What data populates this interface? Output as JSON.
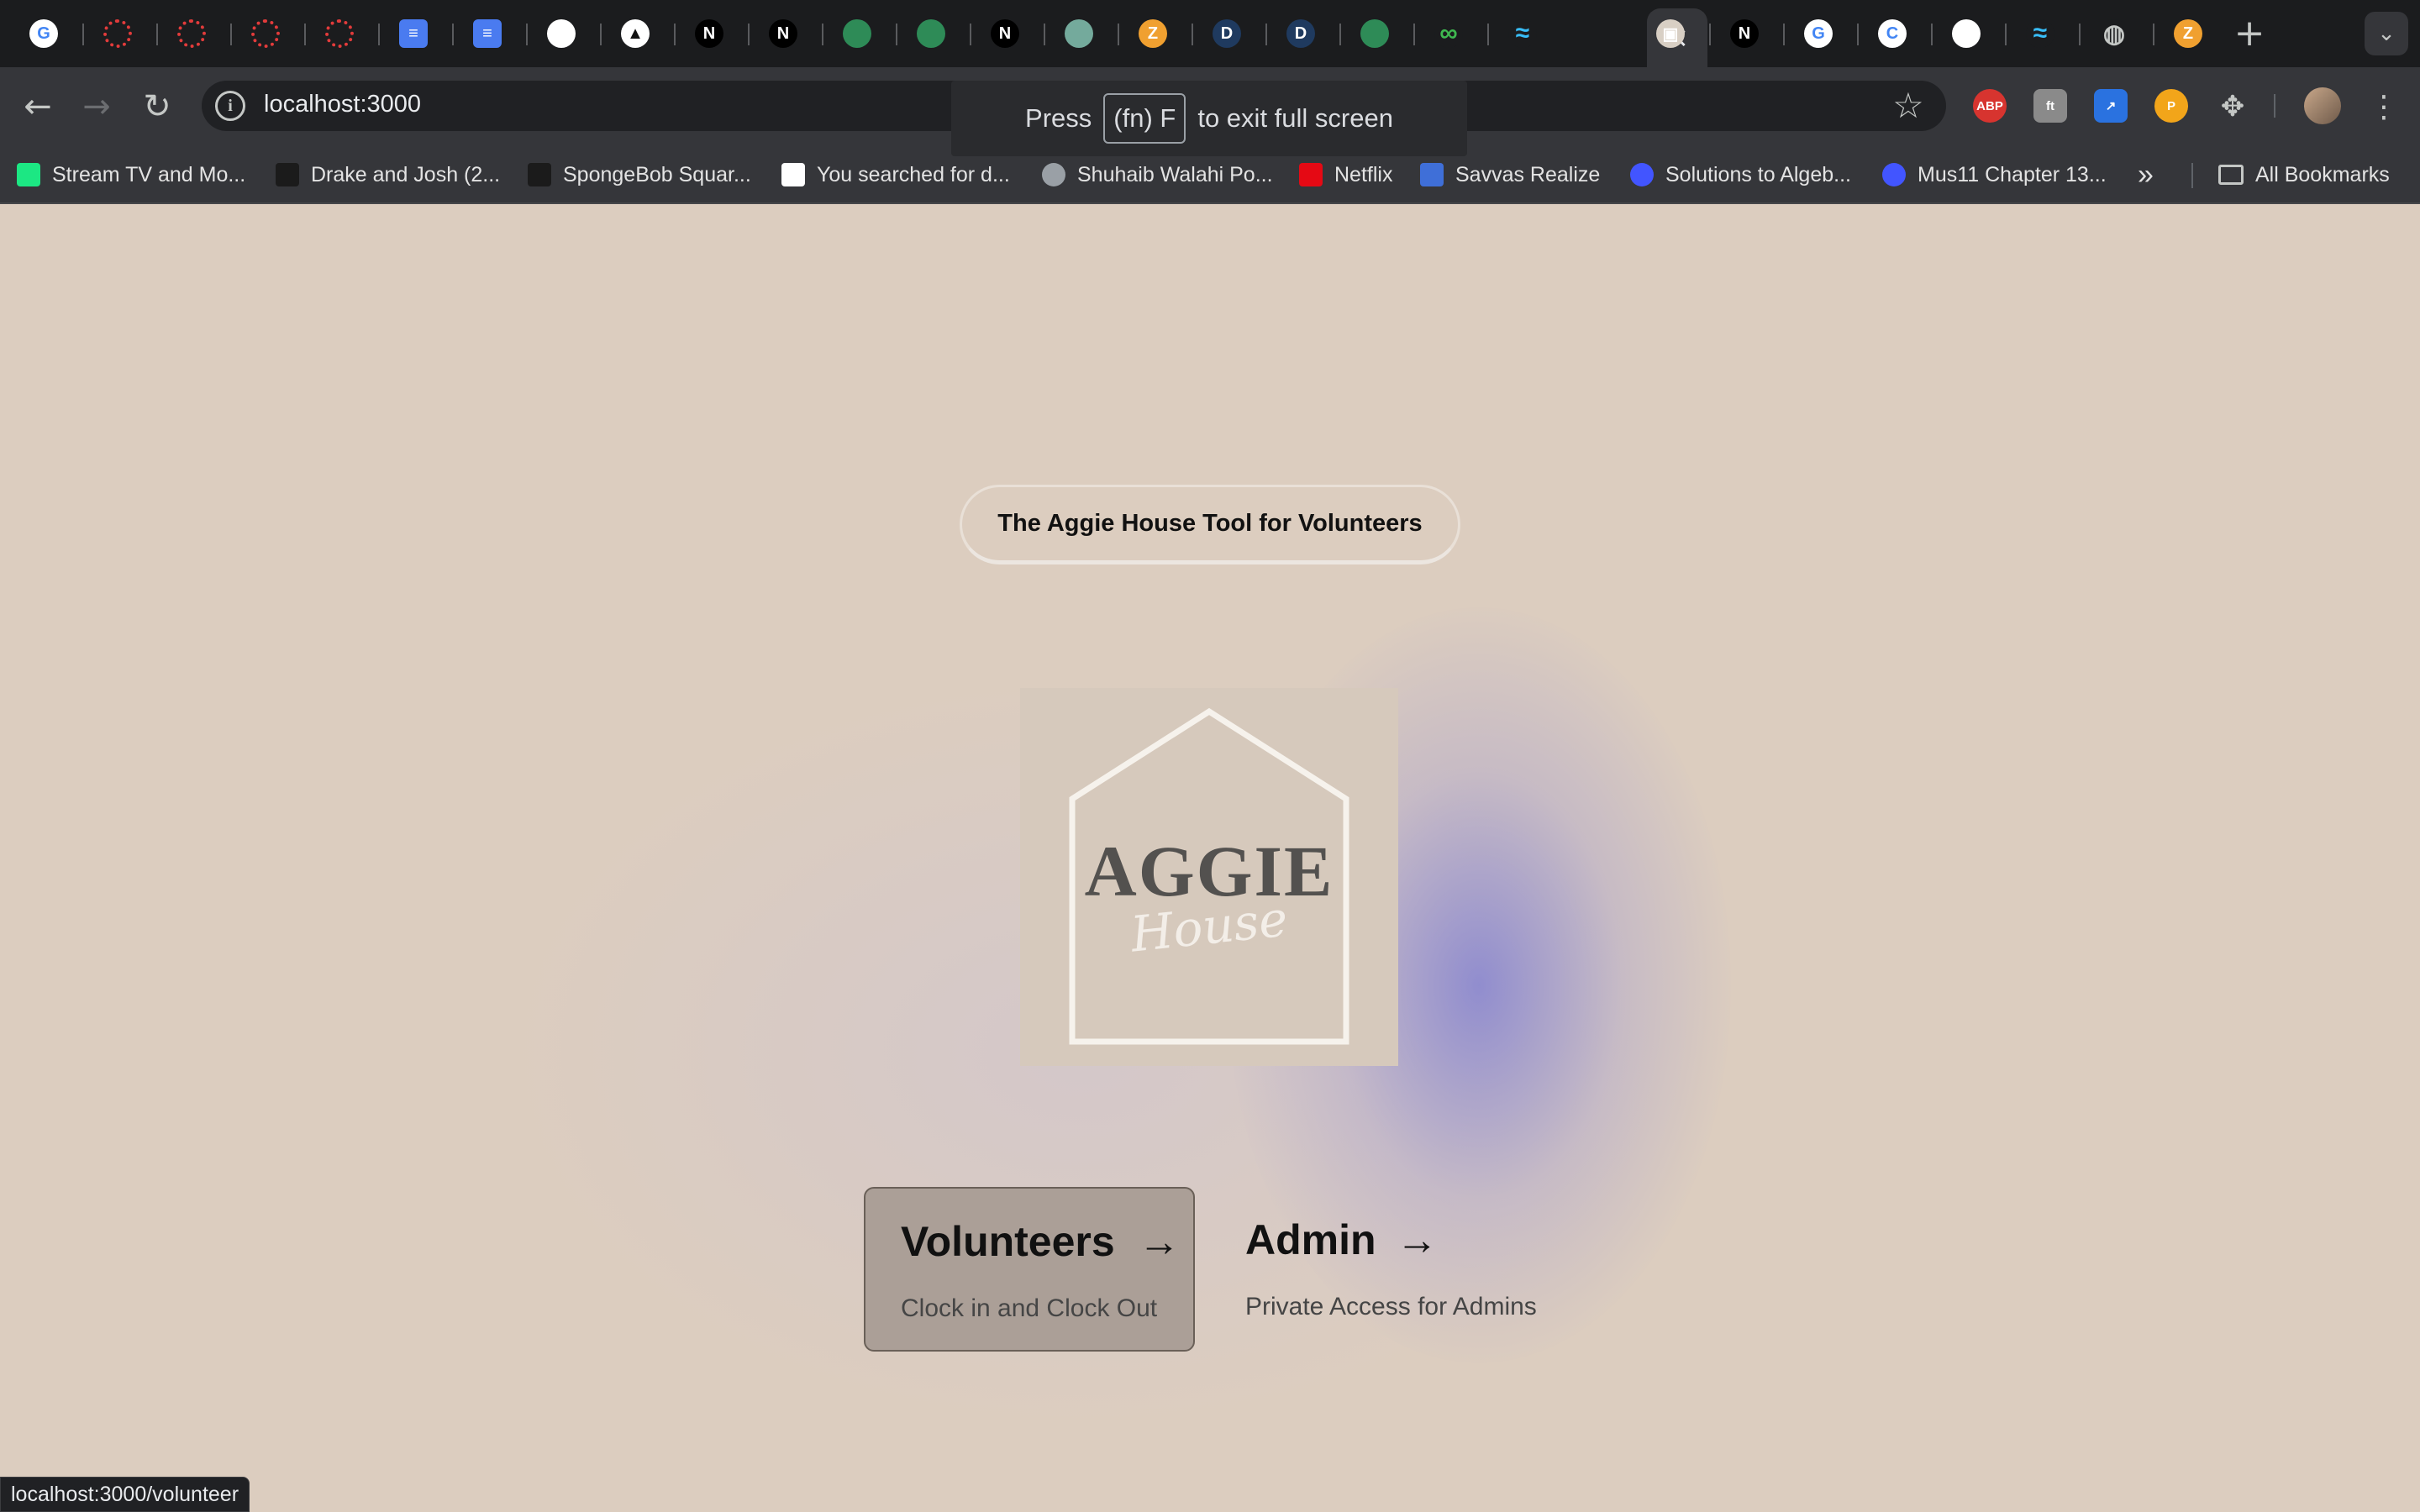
{
  "browser": {
    "tabs": [
      {
        "icon": "google-icon",
        "glyph": "G",
        "color": "#4285f4"
      },
      {
        "icon": "canvas-icon",
        "glyph": "",
        "color": "#e23b3b"
      },
      {
        "icon": "canvas-icon",
        "glyph": "",
        "color": "#e23b3b"
      },
      {
        "icon": "canvas-icon",
        "glyph": "",
        "color": "#e23b3b"
      },
      {
        "icon": "canvas-icon",
        "glyph": "",
        "color": "#e23b3b"
      },
      {
        "icon": "google-docs-icon",
        "glyph": "≡",
        "color": "#4a7bf0"
      },
      {
        "icon": "google-docs-icon",
        "glyph": "≡",
        "color": "#4a7bf0"
      },
      {
        "icon": "github-icon",
        "glyph": "",
        "color": "#ffffff"
      },
      {
        "icon": "vercel-icon",
        "glyph": "▲",
        "color": "#ffffff"
      },
      {
        "icon": "nextjs-icon",
        "glyph": "N",
        "color": "#000000"
      },
      {
        "icon": "nextjs-icon",
        "glyph": "N",
        "color": "#000000"
      },
      {
        "icon": "openai-icon",
        "glyph": "",
        "color": "#2e8b57"
      },
      {
        "icon": "openai-icon",
        "glyph": "",
        "color": "#2e8b57"
      },
      {
        "icon": "nextjs-icon",
        "glyph": "N",
        "color": "#000000"
      },
      {
        "icon": "chatgpt-icon",
        "glyph": "",
        "color": "#74aa9c"
      },
      {
        "icon": "zybooks-icon",
        "glyph": "Z",
        "color": "#f0a030"
      },
      {
        "icon": "d-app-icon",
        "glyph": "D",
        "color": "#1f3a5f"
      },
      {
        "icon": "d-app-icon",
        "glyph": "D",
        "color": "#1f3a5f"
      },
      {
        "icon": "openai-icon",
        "glyph": "",
        "color": "#2e8b57"
      },
      {
        "icon": "infinity-icon",
        "glyph": "∞",
        "color": "#1b1c1e"
      },
      {
        "icon": "tailwind-icon",
        "glyph": "≈",
        "color": "#1b1c1e"
      },
      {
        "icon": "gift-box-icon",
        "glyph": "▣",
        "color": "#d8cfc4"
      },
      {
        "icon": "nextjs-icon",
        "glyph": "N",
        "color": "#000000"
      },
      {
        "icon": "google-icon",
        "glyph": "G",
        "color": "#4285f4"
      },
      {
        "icon": "google-lens-icon",
        "glyph": "C",
        "color": "#4285f4"
      },
      {
        "icon": "github-icon",
        "glyph": "",
        "color": "#ffffff"
      },
      {
        "icon": "tailwind-icon",
        "glyph": "≈",
        "color": "#1b1c1e"
      },
      {
        "icon": "globe-icon",
        "glyph": "◍",
        "color": "#1b1c1e"
      },
      {
        "icon": "zybooks-icon",
        "glyph": "Z",
        "color": "#f0a030"
      }
    ],
    "active_tab_close": "×",
    "new_tab": "+",
    "url": "localhost:3000",
    "fullscreen_notice": {
      "before": "Press",
      "key": "(fn) F",
      "after": "to exit full screen"
    },
    "extensions": [
      {
        "icon": "adblock-plus-icon",
        "label": "ABP",
        "color": "#d7342f"
      },
      {
        "icon": "extension-gray-icon",
        "label": "ft",
        "color": "#8a8a8a"
      },
      {
        "icon": "link-arrow-icon",
        "label": "↗",
        "color": "#2a72e0"
      },
      {
        "icon": "honey-icon",
        "label": "P",
        "color": "#f2a51a"
      }
    ],
    "bookmarks": [
      {
        "label": "Stream TV and Mo...",
        "icon": "hulu-icon",
        "color": "#1ce783"
      },
      {
        "label": "Drake and Josh (2...",
        "icon": "camera-icon",
        "color": "#1b1b1b"
      },
      {
        "label": "SpongeBob Squar...",
        "icon": "gift-icon",
        "color": "#1b1b1b"
      },
      {
        "label": "You searched for d...",
        "icon": "blank-page-icon",
        "color": "#ffffff"
      },
      {
        "label": "Shuhaib Walahi Po...",
        "icon": "globe-icon",
        "color": "#9aa0a6"
      },
      {
        "label": "Netflix",
        "icon": "netflix-icon",
        "color": "#e50914"
      },
      {
        "label": "Savvas Realize",
        "icon": "savvas-icon",
        "color": "#3f6fd8"
      },
      {
        "label": "Solutions to Algeb...",
        "icon": "quizlet-icon",
        "color": "#4255ff"
      },
      {
        "label": "Mus11 Chapter 13...",
        "icon": "quizlet-icon",
        "color": "#4255ff"
      }
    ],
    "more_bookmarks": "»",
    "all_bookmarks": "All Bookmarks"
  },
  "page": {
    "tagline": "The Aggie House Tool for Volunteers",
    "logo": {
      "word": "AGGIE",
      "script": "House"
    },
    "cards": {
      "volunteers": {
        "title": "Volunteers",
        "arrow": "→",
        "subtitle": "Clock in and Clock Out"
      },
      "admin": {
        "title": "Admin",
        "arrow": "→",
        "subtitle": "Private Access for Admins"
      }
    }
  },
  "status_url": "localhost:3000/volunteer",
  "colors": {
    "page_bg": "#dccdbf",
    "volunteer_card": "#ab9f97",
    "glow": "#7878d2"
  }
}
